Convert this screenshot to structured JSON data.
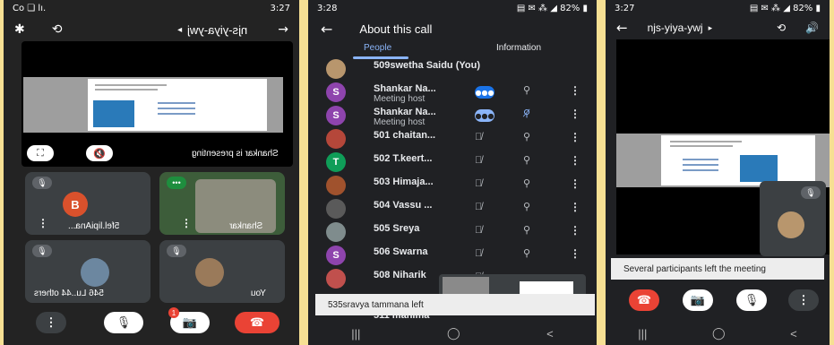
{
  "phone1": {
    "status": {
      "time": "3:27",
      "right": "Co ❏ lı.",
      "left": "ᵢ ıll. ᴿ8 ●"
    },
    "title": "njs-yiya-ywj",
    "presenting_label": "Shankar is presenting",
    "tiles": [
      {
        "name": "5fel.lipiAna...",
        "initial": "B",
        "color": "#d9512c"
      },
      {
        "name": "Shankar",
        "initial": "",
        "color": "#c9b592"
      },
      {
        "name": "546 Lu..44 others",
        "initial": "",
        "color": "#6c87a0"
      },
      {
        "name": "You",
        "initial": "",
        "color": "#9a7a5a"
      }
    ],
    "badge": "1"
  },
  "phone2": {
    "status": {
      "time": "3:28",
      "battery": "82%"
    },
    "title": "About this call",
    "tabs": {
      "people": "People",
      "information": "Information"
    },
    "participants": [
      {
        "name": "509swetha Saidu (You)",
        "sub": "",
        "avatar": "",
        "color": "#b8966d"
      },
      {
        "name": "Shankar Na...",
        "sub": "Meeting host",
        "avatar": "S",
        "color": "#8e44ad"
      },
      {
        "name": "Shankar Na...",
        "sub": "Meeting host",
        "avatar": "S",
        "color": "#8e44ad"
      },
      {
        "name": "501 chaitan...",
        "sub": "",
        "avatar": "",
        "color": "#b5473a"
      },
      {
        "name": "502 T.keert...",
        "sub": "",
        "avatar": "T",
        "color": "#0f9d58"
      },
      {
        "name": "503 Himaja...",
        "sub": "",
        "avatar": "",
        "color": "#a0522d"
      },
      {
        "name": "504 Vassu ...",
        "sub": "",
        "avatar": "",
        "color": "#5a5a5a"
      },
      {
        "name": "505 Sreya",
        "sub": "",
        "avatar": "",
        "color": "#7f8c8d"
      },
      {
        "name": "506 Swarna",
        "sub": "",
        "avatar": "S",
        "color": "#8e44ad"
      },
      {
        "name": "508 Niharik",
        "sub": "",
        "avatar": "",
        "color": "#c0504d"
      },
      {
        "name": "511 manima",
        "sub": "",
        "avatar": "",
        "color": "#7f8c8d"
      }
    ],
    "toast": "535sravya tammana left"
  },
  "phone3": {
    "status": {
      "time": "3:27",
      "battery": "82%"
    },
    "title": "njs-yiya-ywj",
    "toast": "Several participants left the meeting"
  }
}
